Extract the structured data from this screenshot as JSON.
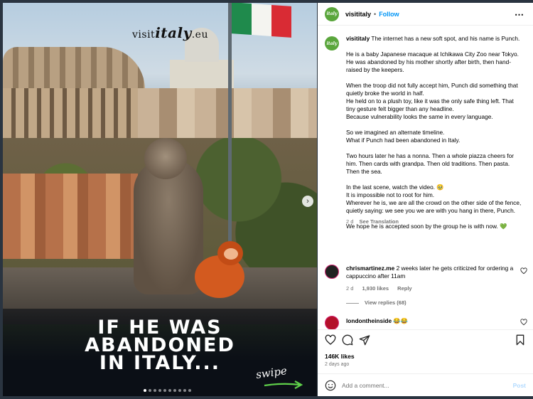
{
  "post_image": {
    "logo_prefix": "visit",
    "logo_brand": "italy",
    "logo_suffix": ".eu",
    "headline_line1": "IF HE WAS",
    "headline_line2": "ABANDONED",
    "headline_line3": "IN ITALY...",
    "swipe_label": "swipe",
    "next_icon": "chevron-right-icon",
    "carousel_total": 10,
    "carousel_active": 1,
    "flag_colors": [
      "#1f8a4c",
      "#f4f4f0",
      "#d92b34"
    ]
  },
  "header": {
    "avatar_label": "italy",
    "username": "visititaly",
    "separator": "•",
    "follow_label": "Follow",
    "more_label": "•••"
  },
  "caption": {
    "username": "visititaly",
    "p1": "The internet has a new soft spot, and his name is Punch.",
    "p2": "He is a baby Japanese macaque at Ichikawa City Zoo near Tokyo. He was abandoned by his mother shortly after birth, then hand-raised by the keepers.",
    "p3": "When the troop did not fully accept him, Punch did something that quietly broke the world in half.\n He held on to a plush toy, like it was the only safe thing left. That tiny gesture felt bigger than any headline.\n Because vulnerability looks the same in every language.",
    "p4": "So we imagined an alternate timeline.\nWhat if Punch had been abandoned in Italy.",
    "p5": "Two hours later he has a nonna. Then a whole piazza cheers for him. Then cards with grandpa. Then old traditions. Then pasta. Then the sea.",
    "p6": "In the last scene, watch the video. 🥹\nIt is impossible not to root for him.\nWherever he is, we are all the crowd on the other side of the fence, quietly saying: we see you we are with you hang in there, Punch.",
    "p7": "We hope he is accepted soon by the group he is with now. 💚",
    "time": "2 d",
    "see_translation": "See Translation"
  },
  "comments": [
    {
      "username": "chrismartinez.me",
      "text": "2 weeks later he gets criticized for ordering a cappuccino after 11am",
      "time": "2 d",
      "likes": "1,930 likes",
      "reply": "Reply",
      "view_replies": "View replies (68)"
    },
    {
      "username": "londontheinside",
      "text": "😂😂"
    }
  ],
  "actions": {
    "likes": "146K likes",
    "posted_ago": "2 days ago"
  },
  "composer": {
    "placeholder": "Add a comment...",
    "post_label": "Post"
  },
  "colors": {
    "accent_blue": "#0095f6",
    "post_disabled": "#b3dbff",
    "brand_green": "#5aa63c"
  }
}
